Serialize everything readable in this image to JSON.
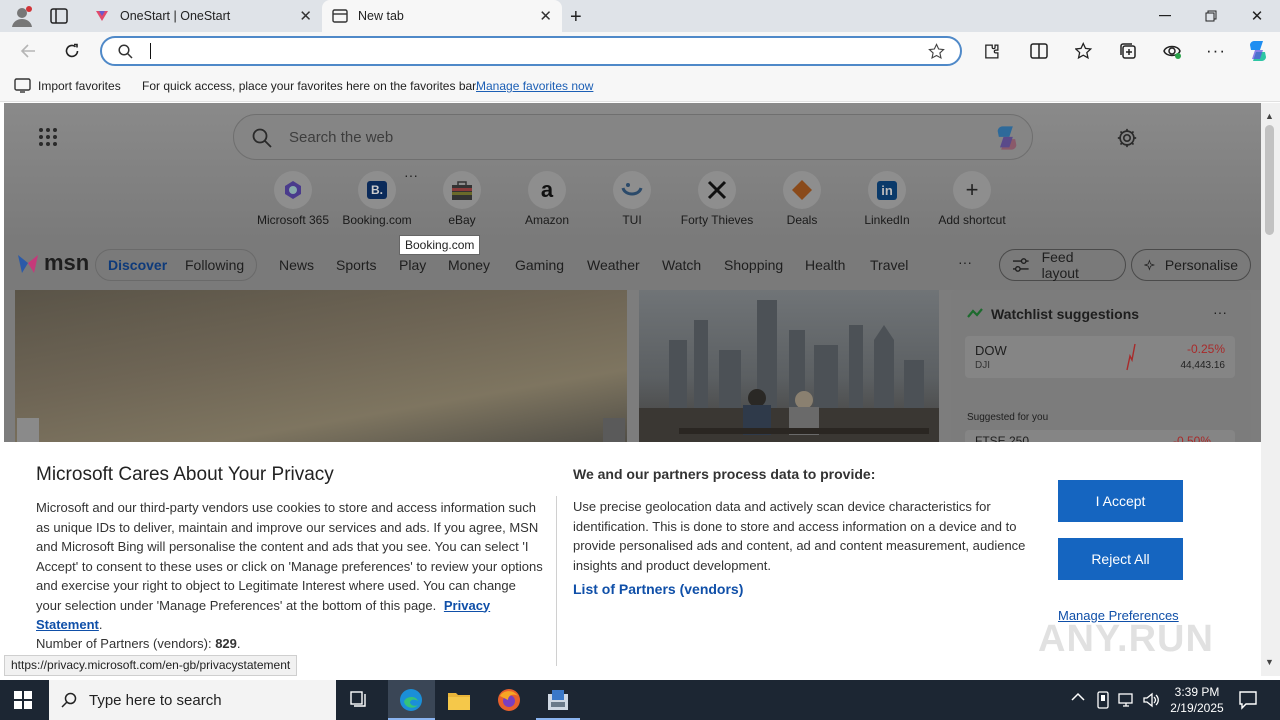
{
  "tabs": [
    {
      "title": "OneStart | OneStart",
      "active": false
    },
    {
      "title": "New tab",
      "active": true
    }
  ],
  "addressbar": {
    "value": ""
  },
  "favorites_bar": {
    "import_label": "Import favorites",
    "hint": "For quick access, place your favorites here on the favorites bar.",
    "manage_link": "Manage favorites now"
  },
  "newtab": {
    "search_placeholder": "Search the web",
    "shortcuts": [
      {
        "label": "Microsoft 365",
        "icon": "microsoft365-icon"
      },
      {
        "label": "Booking.com",
        "icon": "booking-icon",
        "glyph": "B."
      },
      {
        "label": "eBay",
        "icon": "shopping-bag-icon"
      },
      {
        "label": "Amazon",
        "icon": "amazon-icon",
        "glyph": "a"
      },
      {
        "label": "TUI",
        "icon": "tui-icon"
      },
      {
        "label": "Forty Thieves",
        "icon": "crossed-swords-icon"
      },
      {
        "label": "Deals",
        "icon": "tag-icon"
      },
      {
        "label": "LinkedIn",
        "icon": "linkedin-icon",
        "glyph": "in"
      },
      {
        "label": "Add shortcut",
        "icon": "plus-icon",
        "glyph": "+"
      }
    ],
    "tooltip": "Booking.com"
  },
  "msn": {
    "logo_text": "msn",
    "tabs": [
      "Discover",
      "Following"
    ],
    "nav": [
      "News",
      "Sports",
      "Play",
      "Money",
      "Gaming",
      "Weather",
      "Watch",
      "Shopping",
      "Health",
      "Travel"
    ],
    "more": "···",
    "feed_layout": "Feed layout",
    "personalise": "Personalise"
  },
  "watchlist": {
    "title": "Watchlist suggestions",
    "ticker": "DOW",
    "ticker_sub": "DJI",
    "change": "-0.25%",
    "price": "44,443.16",
    "suggested": "Suggested for you",
    "partial_ticker": "FTSE 250",
    "partial_change": "-0.50%",
    "change_color": "#d13438"
  },
  "privacy": {
    "title": "Microsoft Cares About Your Privacy",
    "body": "Microsoft and our third-party vendors use cookies to store and access information such as unique IDs to deliver, maintain and improve our services and ads. If you agree, MSN and Microsoft Bing will personalise the content and ads that you see. You can select 'I Accept' to consent to these uses or click on 'Manage preferences' to review your options and exercise your right to object to Legitimate Interest where used.  You can change your selection under 'Manage Preferences' at the bottom of this page.",
    "privacy_link": "Privacy Statement",
    "partners_label": "Number of Partners (vendors):",
    "partners_count": "829",
    "right_title": "We and our partners process data to provide:",
    "right_body": "Use precise geolocation data and actively scan device characteristics for identification. This is done to store and access information on a device and to provide personalised ads and content, ad and content measurement, audience insights and product development.",
    "partners_link": "List of Partners (vendors)",
    "accept": "I Accept",
    "reject": "Reject All",
    "manage": "Manage Preferences",
    "accent": "#1565c0"
  },
  "status_url": "https://privacy.microsoft.com/en-gb/privacystatement",
  "watermark": "ANY.RUN",
  "taskbar": {
    "search_placeholder": "Type here to search",
    "time": "3:39 PM",
    "date": "2/19/2025"
  }
}
